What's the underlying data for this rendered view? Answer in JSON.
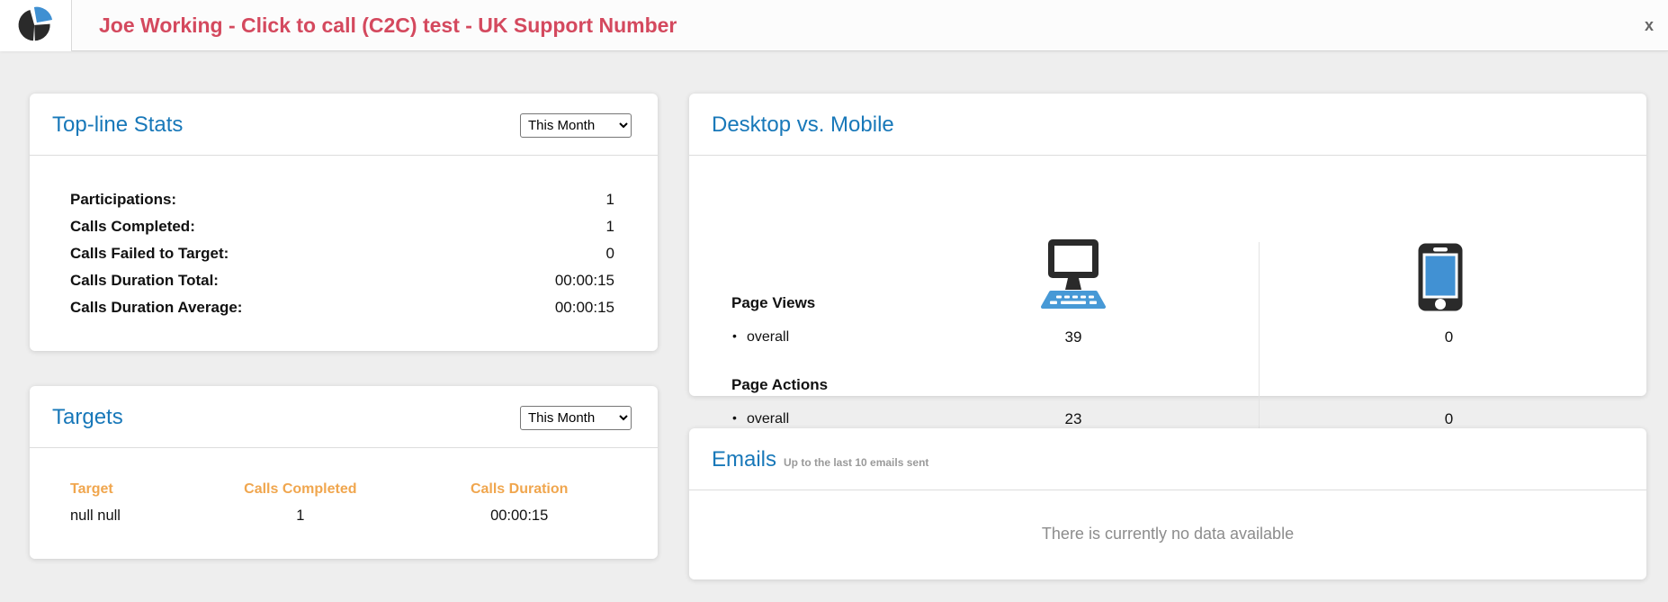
{
  "header": {
    "title": "Joe Working - Click to call (C2C) test - UK Support Number",
    "close_label": "x",
    "logo_icon": "pie-chart-icon"
  },
  "colors": {
    "title_red": "#d4495e",
    "heading_blue": "#1878b9",
    "table_header_orange": "#f0a64e",
    "icon_blue": "#4799d6",
    "icon_dark": "#2a2a2a",
    "muted_gray": "#8c8c8c"
  },
  "top_line_stats": {
    "title": "Top-line Stats",
    "period_selected": "This Month",
    "rows": [
      {
        "label": "Participations:",
        "value": "1"
      },
      {
        "label": "Calls Completed:",
        "value": "1"
      },
      {
        "label": "Calls Failed to Target:",
        "value": "0"
      },
      {
        "label": "Calls Duration Total:",
        "value": "00:00:15"
      },
      {
        "label": "Calls Duration Average:",
        "value": "00:00:15"
      }
    ]
  },
  "targets": {
    "title": "Targets",
    "period_selected": "This Month",
    "columns": [
      "Target",
      "Calls Completed",
      "Calls Duration"
    ],
    "rows": [
      {
        "target": "null null",
        "calls_completed": "1",
        "calls_duration": "00:00:15"
      }
    ]
  },
  "desktop_vs_mobile": {
    "title": "Desktop vs. Mobile",
    "page_views": {
      "label": "Page Views",
      "overall": {
        "label": "overall",
        "desktop": "39",
        "mobile": "0"
      }
    },
    "page_actions": {
      "label": "Page Actions",
      "overall": {
        "label": "overall",
        "desktop": "23",
        "mobile": "0"
      }
    }
  },
  "emails": {
    "title": "Emails",
    "subtitle": "Up to the last 10 emails sent",
    "empty_message": "There is currently no data available"
  }
}
